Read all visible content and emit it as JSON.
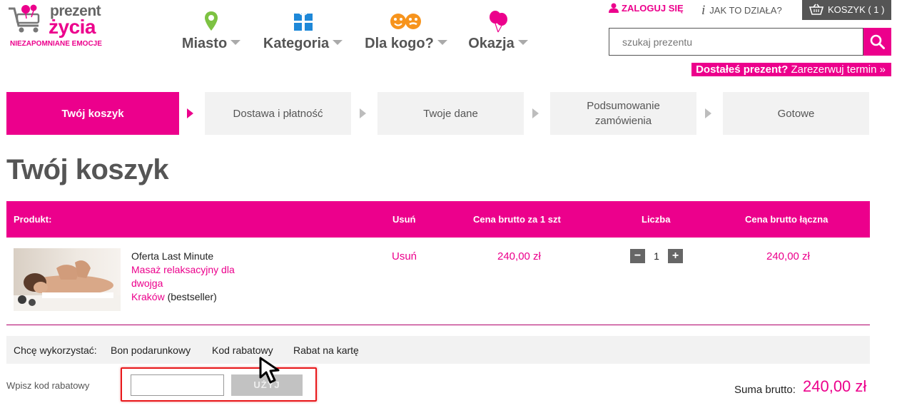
{
  "brand": {
    "name_line1": "prezent",
    "name_line2": "życia",
    "tagline": "NIEZAPOMNIANE EMOCJE"
  },
  "nav": [
    {
      "label": "Miasto",
      "icon": "map-pin-icon"
    },
    {
      "label": "Kategoria",
      "icon": "gift-box-icon"
    },
    {
      "label": "Dla kogo?",
      "icon": "faces-icon"
    },
    {
      "label": "Okazja",
      "icon": "balloons-icon"
    }
  ],
  "header": {
    "login_label": "ZALOGUJ SIĘ",
    "howto_label": "JAK TO DZIAŁA?",
    "cart_label": "KOSZYK ( 1 )",
    "search_placeholder": "szukaj prezentu",
    "promo_bold": "Dostałeś prezent?",
    "promo_rest": " Zarezerwuj termin »"
  },
  "steps": [
    {
      "label": "Twój koszyk",
      "active": true
    },
    {
      "label": "Dostawa i płatność",
      "active": false
    },
    {
      "label": "Twoje dane",
      "active": false
    },
    {
      "label": "Podsumowanie zamówienia",
      "active": false
    },
    {
      "label": "Gotowe",
      "active": false
    }
  ],
  "page_title": "Twój koszyk",
  "table": {
    "headers": {
      "product": "Produkt:",
      "remove": "Usuń",
      "unit_price": "Cena brutto za 1 szt",
      "quantity": "Liczba",
      "total": "Cena brutto łączna"
    },
    "rows": [
      {
        "name": "Oferta Last Minute",
        "description": "Masaż relaksacyjny dla dwojga",
        "city": "Kraków",
        "badge": " (bestseller)",
        "remove_label": "Usuń",
        "unit_price": "240,00 zł",
        "quantity": "1",
        "minus": "−",
        "plus": "+",
        "total": "240,00 zł"
      }
    ]
  },
  "discount": {
    "prompt": "Chcę wykorzystać:",
    "options": [
      "Bon podarunkowy",
      "Kod rabatowy",
      "Rabat na kartę"
    ],
    "code_label": "Wpisz kod rabatowy",
    "code_value": "",
    "apply_label": "UŻYJ"
  },
  "summary": {
    "label": "Suma brutto:",
    "value": "240,00 zł"
  },
  "colors": {
    "accent": "#ec008c",
    "dark": "#555555",
    "light_bg": "#f2f2f2",
    "highlight": "#e8181b"
  }
}
